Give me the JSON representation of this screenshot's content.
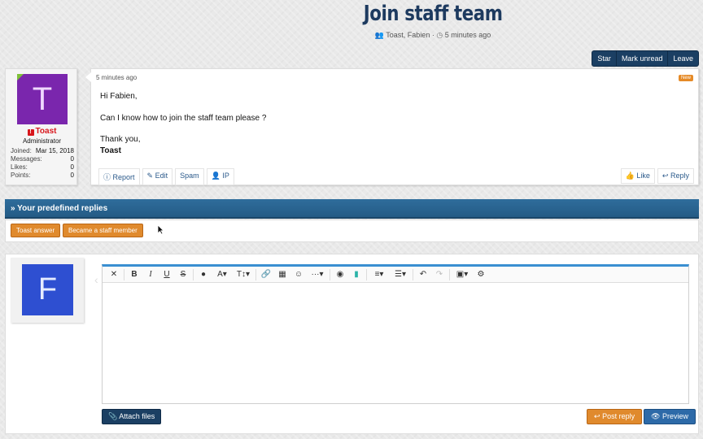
{
  "page": {
    "title": "Join staff team",
    "participants": "Toast, Fabien",
    "time": "5 minutes ago"
  },
  "thread_actions": [
    "Star",
    "Mark unread",
    "Leave"
  ],
  "post": {
    "author": {
      "initial": "T",
      "name": "Toast",
      "role": "Administrator",
      "stats": [
        {
          "label": "Joined:",
          "value": "Mar 15, 2018"
        },
        {
          "label": "Messages:",
          "value": "0"
        },
        {
          "label": "Likes:",
          "value": "0"
        },
        {
          "label": "Points:",
          "value": "0"
        }
      ]
    },
    "date": "5 minutes ago",
    "badge": "New",
    "greeting": "Hi Fabien,",
    "line1": "Can I know how to join the staff team please ?",
    "closing": "Thank you,",
    "signature": "Toast",
    "actions": {
      "report": "Report",
      "edit": "Edit",
      "spam": "Spam",
      "ip": "IP",
      "like": "Like",
      "reply": "Reply"
    }
  },
  "replies": {
    "header": "Your predefined replies",
    "buttons": [
      "Toast answer",
      "Became a staff member"
    ]
  },
  "composer": {
    "initial": "F",
    "attach_label": "Attach files",
    "post_reply_label": "Post reply",
    "preview_label": "Preview"
  },
  "colors": {
    "title": "#1d3a5f",
    "accent_orange": "#e08a2d",
    "nav_dark": "#1b3f63",
    "section_blue": "#2f6d9c"
  }
}
